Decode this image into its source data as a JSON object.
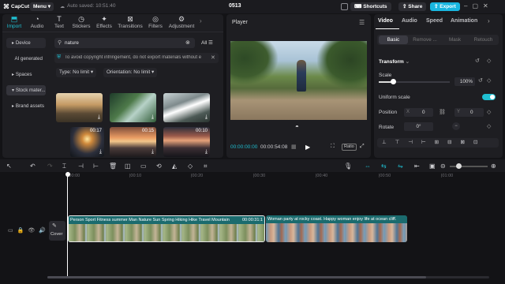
{
  "app": {
    "logo": "CapCut",
    "menu_label": "Menu",
    "autosave": "Auto saved: 10:51:40",
    "project_title": "0513",
    "shortcuts_label": "Shortcuts",
    "share_label": "Share",
    "export_label": "Export"
  },
  "media_tabs": [
    {
      "label": "Import",
      "icon": "import-icon"
    },
    {
      "label": "Audio",
      "icon": "audio-icon"
    },
    {
      "label": "Text",
      "icon": "text-icon"
    },
    {
      "label": "Stickers",
      "icon": "stickers-icon"
    },
    {
      "label": "Effects",
      "icon": "effects-icon"
    },
    {
      "label": "Transitions",
      "icon": "transitions-icon"
    },
    {
      "label": "Filters",
      "icon": "filters-icon"
    },
    {
      "label": "Adjustment",
      "icon": "adjustment-icon"
    }
  ],
  "sidebar": [
    "Device",
    "AI generated",
    "Spaces",
    "Stock mater...",
    "Brand assets"
  ],
  "search": {
    "value": "nature",
    "all_label": "All"
  },
  "notice": "To avoid copyright infringement, do not export materials without e",
  "filters": {
    "type": "Type: No limit",
    "orientation": "Orientation: No limit"
  },
  "thumbs": [
    {
      "duration": ""
    },
    {
      "duration": ""
    },
    {
      "duration": ""
    },
    {
      "duration": "00:17"
    },
    {
      "duration": "00:15"
    },
    {
      "duration": "00:10"
    }
  ],
  "player": {
    "title": "Player",
    "current_time": "00:00:00:00",
    "total_time": "00:00:54:08",
    "ratio_label": "Ratio"
  },
  "inspector": {
    "tabs": [
      "Video",
      "Audio",
      "Speed",
      "Animation"
    ],
    "subtabs": [
      "Basic",
      "Remove ...",
      "Mask",
      "Retouch"
    ],
    "transform_label": "Transform",
    "scale_label": "Scale",
    "scale_value": "100%",
    "scale_level_percent": 100,
    "uniform_scale_label": "Uniform scale",
    "position_label": "Position",
    "pos_x_label": "X",
    "pos_x_value": "0",
    "pos_y_label": "Y",
    "pos_y_value": "0",
    "rotate_label": "Rotate",
    "rotate_value": "0°"
  },
  "timeline": {
    "ticks": [
      "|00:00",
      "|00:10",
      "|00:20",
      "|00:30",
      "|00:40",
      "|00:50",
      "|01:00"
    ],
    "cover_label": "Cover",
    "clip1": {
      "title": "Person Sport Fitness summer Man Nature Sun Spring Hiking Hike Travel Mountain",
      "duration": "00:00:31:1"
    },
    "clip2": {
      "title": "Woman party at rocky coast. Happy woman enjoy life at ocean cliff."
    }
  },
  "colors": {
    "accent": "#1fbfd1",
    "export": "#19b6e0",
    "bg": "#131316",
    "panel": "#1e1e22"
  }
}
